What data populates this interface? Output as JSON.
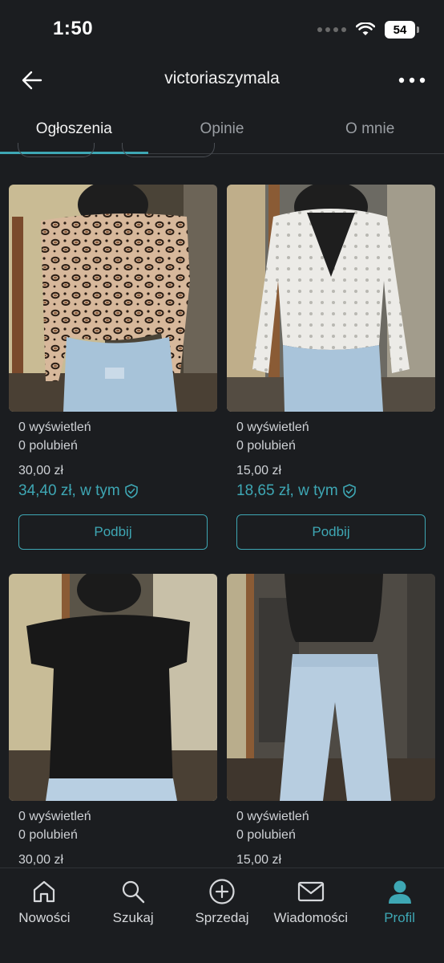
{
  "status_bar": {
    "time": "1:50",
    "battery": "54"
  },
  "header": {
    "title": "victoriaszymala",
    "back_icon": "arrow-left-icon",
    "more_icon": "more-horizontal-icon"
  },
  "tabs": [
    {
      "label": "Ogłoszenia",
      "active": true
    },
    {
      "label": "Opinie",
      "active": false
    },
    {
      "label": "O mnie",
      "active": false
    }
  ],
  "items": [
    {
      "views": "0 wyświetleń",
      "likes": "0 polubień",
      "price": "30,00 zł",
      "total": "34,40 zł, w tym",
      "boost_label": "Podbij",
      "photo": "leopard print off-shoulder top"
    },
    {
      "views": "0 wyświetleń",
      "likes": "0 polubień",
      "price": "15,00 zł",
      "total": "18,65 zł, w tym",
      "boost_label": "Podbij",
      "photo": "white lace blouse"
    },
    {
      "views": "0 wyświetleń",
      "likes": "0 polubień",
      "price": "30,00 zł",
      "photo": "black off-shoulder top"
    },
    {
      "views": "0 wyświetleń",
      "likes": "0 polubień",
      "price": "15,00 zł",
      "photo": "light blue wide jeans"
    }
  ],
  "bottom_nav": [
    {
      "label": "Nowości",
      "icon": "home-icon",
      "active": false
    },
    {
      "label": "Szukaj",
      "icon": "search-icon",
      "active": false
    },
    {
      "label": "Sprzedaj",
      "icon": "plus-circle-icon",
      "active": false
    },
    {
      "label": "Wiadomości",
      "icon": "mail-icon",
      "active": false
    },
    {
      "label": "Profil",
      "icon": "profile-icon",
      "active": true
    }
  ],
  "colors": {
    "accent": "#3ea7b4",
    "background": "#1b1d20",
    "text": "#cfd2d6"
  }
}
